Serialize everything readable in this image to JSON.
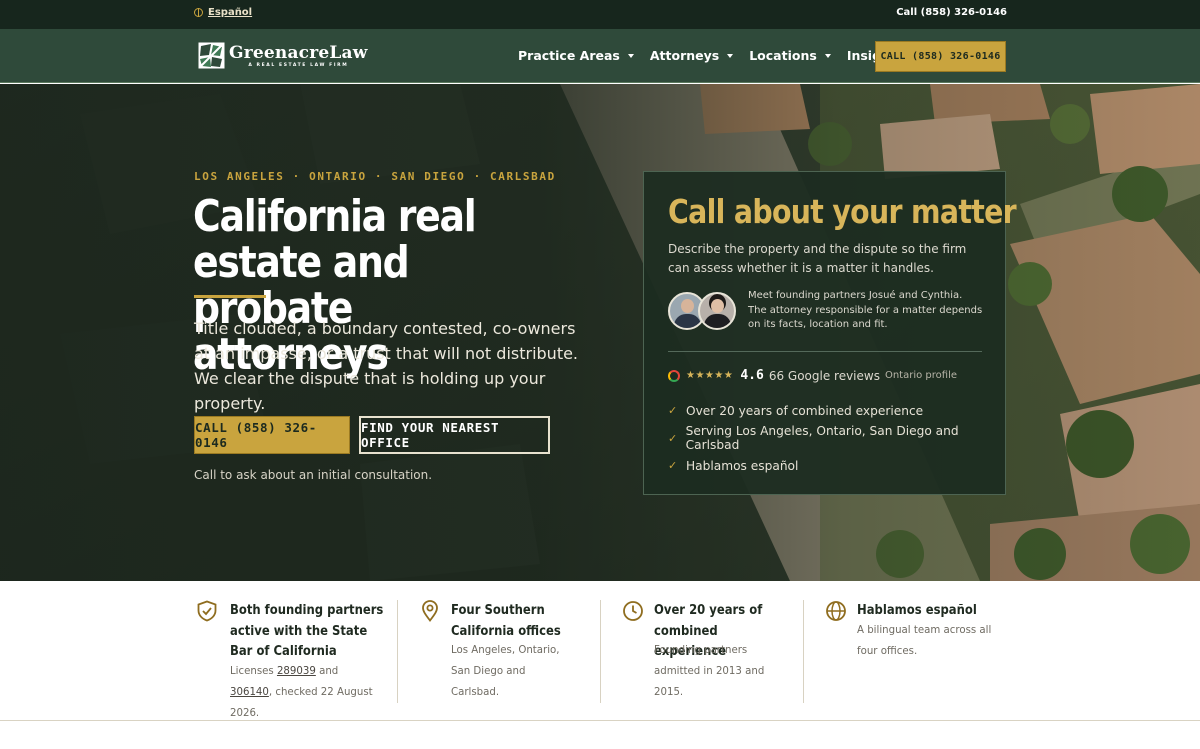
{
  "topbar": {
    "language_label": "Español",
    "call_text": "Call (858) 326-0146"
  },
  "header": {
    "logo_name": "GreenacreLaw",
    "logo_tagline": "A REAL ESTATE LAW FIRM",
    "nav": [
      {
        "label": "Practice Areas"
      },
      {
        "label": "Attorneys"
      },
      {
        "label": "Locations"
      },
      {
        "label": "Insights"
      }
    ],
    "cta_label": "CALL (858) 326-0146"
  },
  "hero": {
    "eyebrow": "LOS ANGELES · ONTARIO · SAN DIEGO · CARLSBAD",
    "title": "California real estate and probate attorneys",
    "subtitle": "Title clouded, a boundary contested, co-owners at an impasse, or a trust that will not distribute. We clear the dispute that is holding up your property.",
    "primary_button": "CALL (858) 326-0146",
    "secondary_button": "FIND YOUR NEAREST OFFICE",
    "note": "Call to ask about an initial consultation."
  },
  "card": {
    "title": "Call about your matter",
    "description": "Describe the property and the dispute so the firm can assess whether it is a matter it handles.",
    "partners_text": "Meet founding partners Josué and Cynthia. The attorney responsible for a matter depends on its facts, location and fit.",
    "stars": "★★★★★",
    "rating": "4.6",
    "review_count": "66 Google reviews",
    "review_profile": "Ontario profile",
    "checks": [
      {
        "text": "Over 20 years of combined experience"
      },
      {
        "text": "Serving Los Angeles, Ontario, San Diego and Carlsbad"
      },
      {
        "text": "Hablamos español"
      }
    ]
  },
  "trust": [
    {
      "title": "Both founding partners active with the State Bar of California",
      "body_prefix": "Licenses ",
      "license_1": "289039",
      "body_mid": " and ",
      "license_2": "306140",
      "body_suffix": ", checked 22 August 2026."
    },
    {
      "title": "Four Southern California offices",
      "body": "Los Angeles, Ontario, San Diego and Carlsbad."
    },
    {
      "title": "Over 20 years of combined experience",
      "body": "Founding partners admitted in 2013 and 2015."
    },
    {
      "title": "Hablamos español",
      "body": "A bilingual team across all four offices."
    }
  ],
  "colors": {
    "brand_dark": "#17261d",
    "header_green": "#2f4a3a",
    "accent_gold": "#c9a43e",
    "card_bg": "#1c2c21"
  },
  "icons": {
    "language": "globe-icon",
    "trust_1": "shield-check-icon",
    "trust_2": "map-pin-icon",
    "trust_3": "clock-icon",
    "trust_4": "globe-icon",
    "review_source": "google-icon",
    "checklist": "checkmark-icon"
  }
}
